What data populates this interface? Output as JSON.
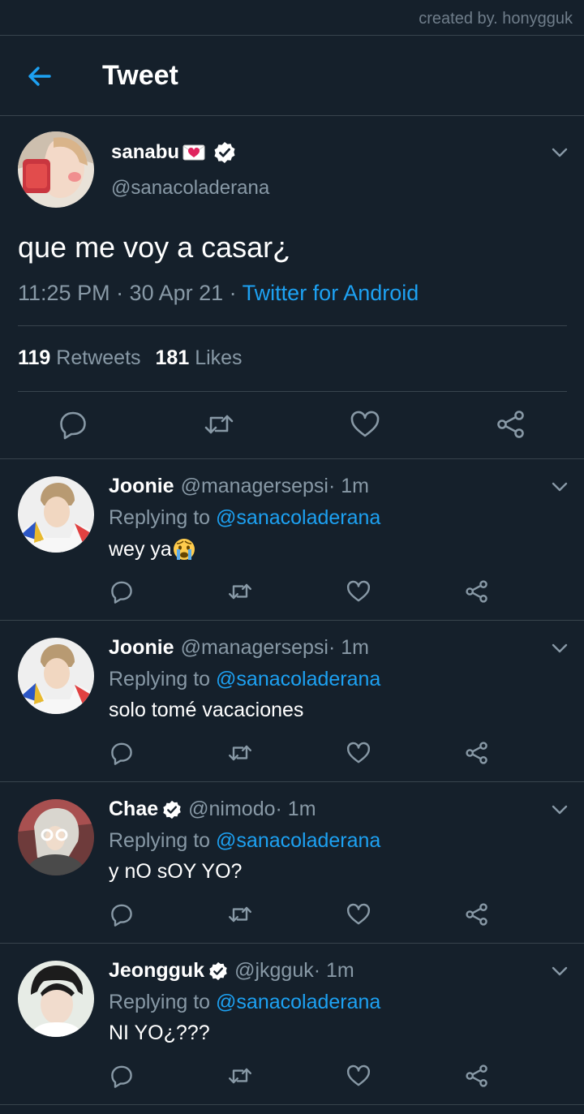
{
  "credit": "created by. honygguk",
  "header": {
    "title": "Tweet"
  },
  "tweet": {
    "name": "sanabu",
    "handle": "@sanacoladerana",
    "text": "que me voy a casar¿",
    "time": "11:25 PM · 30 Apr 21 · ",
    "source": "Twitter for Android",
    "retweets_count": "119",
    "retweets_label": "Retweets",
    "likes_count": "181",
    "likes_label": "Likes"
  },
  "replies": [
    {
      "name": "Joonie",
      "handle": "@managersepsi",
      "time": " · 1m",
      "replying_prefix": "Replying to ",
      "mention": "@sanacoladerana",
      "text": "wey ya",
      "verified": false
    },
    {
      "name": "Joonie",
      "handle": "@managersepsi",
      "time": " · 1m",
      "replying_prefix": "Replying to ",
      "mention": "@sanacoladerana",
      "text": "solo tomé vacaciones",
      "verified": false
    },
    {
      "name": "Chae",
      "handle": "@nimodo",
      "time": " · 1m",
      "replying_prefix": "Replying to ",
      "mention": "@sanacoladerana",
      "text": "y nO sOY YO?",
      "verified": true
    },
    {
      "name": "Jeongguk",
      "handle": "@jkgguk",
      "time": " · 1m",
      "replying_prefix": "Replying to ",
      "mention": "@sanacoladerana",
      "text": "NI YO¿???",
      "verified": true
    }
  ],
  "colors": {
    "background": "#15202b",
    "accent": "#1da1f2",
    "secondary_text": "#8899a6",
    "divider": "#38444d"
  }
}
